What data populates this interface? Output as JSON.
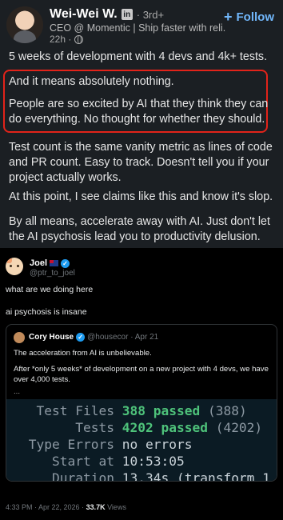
{
  "linkedin": {
    "author_name": "Wei-Wei W.",
    "badge_glyph": "in",
    "degree": "· 3rd+",
    "follow_label": "Follow",
    "follow_icon": "+",
    "headline": "CEO @ Momentic | Ship faster with reli...",
    "time": "22h ·",
    "paragraphs": [
      "5 weeks of development with 4 devs and 4k+ tests.",
      "And it means absolutely nothing.",
      "People are so excited by AI that they think they can do everything. No thought for whether they should.",
      "Test count is the same vanity metric as lines of code and PR count. Easy to track. Doesn't tell you if your project actually works.",
      "At this point, I see claims like this and know it's slop.",
      "By all means, accelerate away with AI. Just don't let the AI psychosis lead you to productivity delusion."
    ],
    "highlight_color": "#e2231a",
    "accent_color": "#71b7fb"
  },
  "tweet": {
    "name": "Joel",
    "handle": "@ptr_to_joel",
    "lines": [
      "what are we doing here",
      "ai psychosis is insane"
    ],
    "quote": {
      "name": "Cory House",
      "handle": "@housecor · Apr 21",
      "text1": "The acceleration from AI is unbelievable.",
      "text2": "After *only 5 weeks* of development on a new project with 4 devs, we have over 4,000 tests.",
      "text3": "...",
      "terminal": [
        {
          "label": "Test Files",
          "value_strong": "388 passed",
          "value_rest": " (388)"
        },
        {
          "label": "Tests",
          "value_strong": "4202 passed",
          "value_rest": " (4202)"
        },
        {
          "label": "Type Errors",
          "value_strong": "",
          "value_rest": "no errors"
        },
        {
          "label": "Start at",
          "value_strong": "",
          "value_rest": "10:53:05"
        },
        {
          "label": "Duration",
          "value_strong": "",
          "value_rest": "13.34s (transform 1"
        }
      ]
    },
    "footer_time": "4:33 PM · Apr 22, 2026 · ",
    "views_count": "33.7K",
    "views_label": " Views"
  }
}
